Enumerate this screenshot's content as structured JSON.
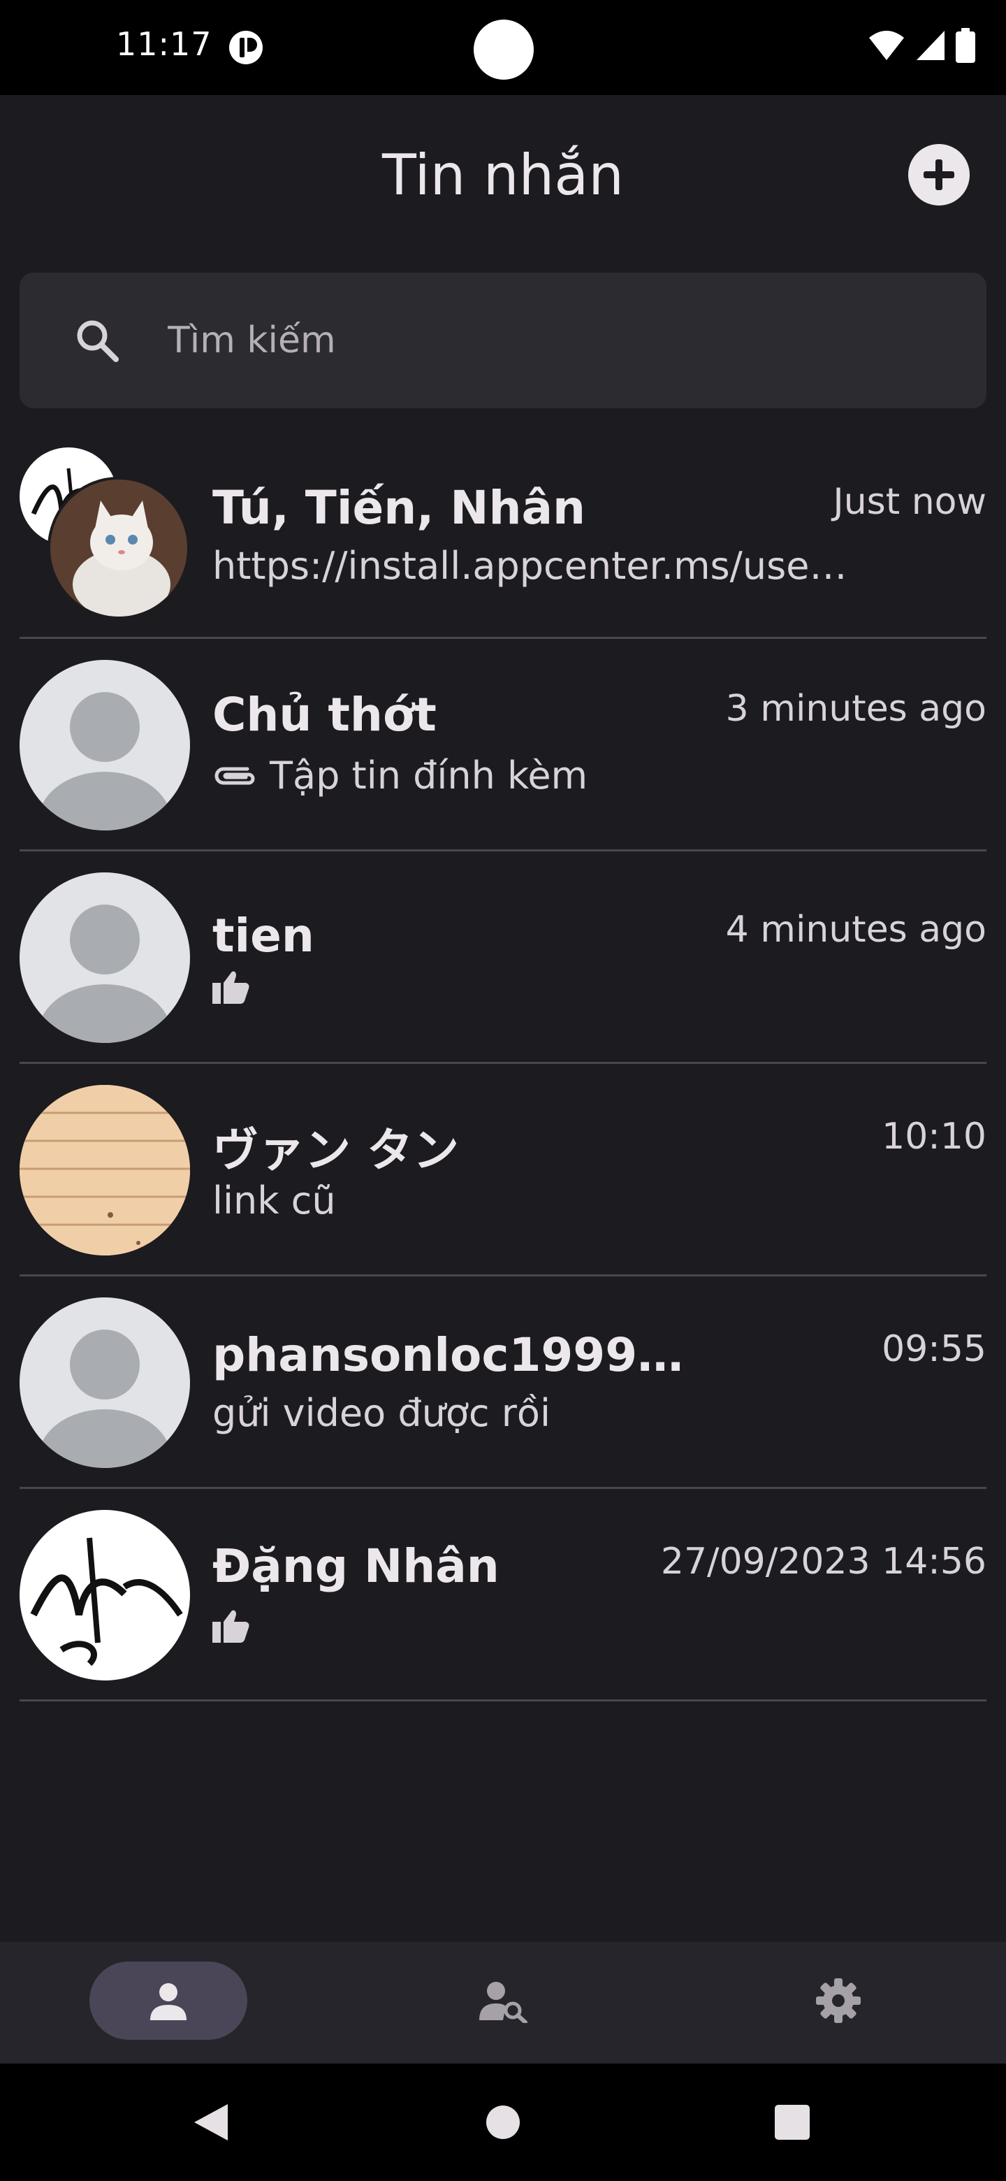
{
  "status_bar": {
    "time": "11:17",
    "icons": [
      "app-notification-icon",
      "wifi-icon",
      "cell-signal-icon",
      "battery-icon"
    ]
  },
  "header": {
    "title": "Tin nhắn",
    "add_icon": "plus-icon"
  },
  "search": {
    "placeholder": "Tìm kiếm",
    "value": "",
    "icon": "search-icon"
  },
  "conversations": [
    {
      "name": "Tú, Tiến, Nhân",
      "time": "Just now",
      "preview": "https://install.appcenter.ms/use…",
      "preview_icon": "",
      "avatar": "group-avatar-cat-calligraphy"
    },
    {
      "name": "Chủ thớt",
      "time": "3 minutes ago",
      "preview": "Tập tin đính kèm",
      "preview_icon": "paperclip-icon",
      "avatar": "default-person-avatar"
    },
    {
      "name": "tien",
      "time": "4 minutes ago",
      "preview": "",
      "preview_icon": "thumbs-up-icon",
      "avatar": "default-person-avatar"
    },
    {
      "name": "ヴァン タン",
      "time": "10:10",
      "preview": "link cũ",
      "preview_icon": "",
      "avatar": "wood-texture-avatar"
    },
    {
      "name": "phansonloc1999…",
      "time": "09:55",
      "preview": "gửi video được rồi",
      "preview_icon": "",
      "avatar": "default-person-avatar"
    },
    {
      "name": "Đặng Nhân",
      "time": "27/09/2023 14:56",
      "preview": "",
      "preview_icon": "thumbs-up-icon",
      "avatar": "calligraphy-avatar"
    }
  ],
  "bottom_nav": {
    "items": [
      {
        "icon": "person-icon",
        "active": true
      },
      {
        "icon": "person-search-icon",
        "active": false
      },
      {
        "icon": "gear-icon",
        "active": false
      }
    ]
  },
  "system_nav": {
    "buttons": [
      "back-icon",
      "home-icon",
      "recents-icon"
    ]
  },
  "colors": {
    "background": "#1c1b20",
    "search_bg": "#2c2c30",
    "nav_bg": "#26252c",
    "nav_active": "#4a4658",
    "divider": "#48474c",
    "text": "#ece7eb"
  }
}
